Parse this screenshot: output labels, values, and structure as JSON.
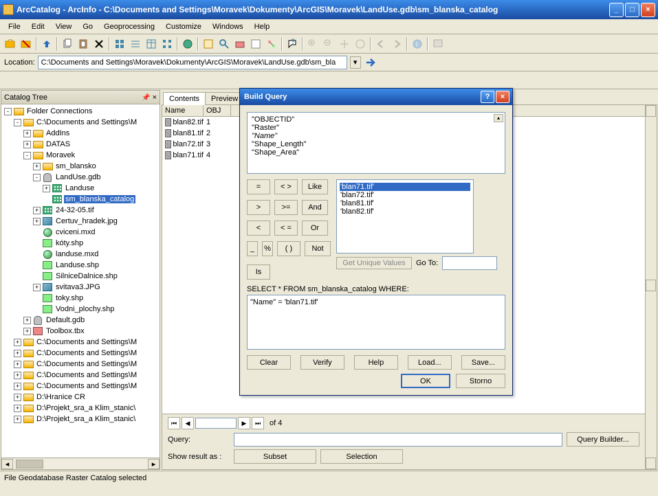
{
  "titlebar": "ArcCatalog - ArcInfo - C:\\Documents and Settings\\Moravek\\Dokumenty\\ArcGIS\\Moravek\\LandUse.gdb\\sm_blanska_catalog",
  "menu": [
    "File",
    "Edit",
    "View",
    "Go",
    "Geoprocessing",
    "Customize",
    "Windows",
    "Help"
  ],
  "location_label": "Location:",
  "location_value": "C:\\Documents and Settings\\Moravek\\Dokumenty\\ArcGIS\\Moravek\\LandUse.gdb\\sm_bla",
  "sidebar_title": "Catalog Tree",
  "tree": [
    {
      "ind": 0,
      "exp": "-",
      "icon": "fold-open",
      "label": "Folder Connections"
    },
    {
      "ind": 1,
      "exp": "-",
      "icon": "fold-open",
      "label": "C:\\Documents and Settings\\M"
    },
    {
      "ind": 2,
      "exp": "+",
      "icon": "fold",
      "label": "AddIns"
    },
    {
      "ind": 2,
      "exp": "+",
      "icon": "fold",
      "label": "DATAS"
    },
    {
      "ind": 2,
      "exp": "-",
      "icon": "fold-open",
      "label": "Moravek"
    },
    {
      "ind": 3,
      "exp": "+",
      "icon": "fold",
      "label": "sm_blansko"
    },
    {
      "ind": 3,
      "exp": "-",
      "icon": "db",
      "label": "LandUse.gdb"
    },
    {
      "ind": 4,
      "exp": "+",
      "icon": "grid-ic",
      "label": "Landuse"
    },
    {
      "ind": 4,
      "exp": "",
      "icon": "grid-ic",
      "label": "sm_blanska_catalog",
      "sel": true
    },
    {
      "ind": 3,
      "exp": "+",
      "icon": "grid-ic",
      "label": "24-32-05.tif"
    },
    {
      "ind": 3,
      "exp": "+",
      "icon": "img-ic",
      "label": "Certuv_hradek.jpg"
    },
    {
      "ind": 3,
      "exp": "",
      "icon": "globe-ic",
      "label": "cviceni.mxd"
    },
    {
      "ind": 3,
      "exp": "",
      "icon": "shp-ic",
      "label": "kóty.shp"
    },
    {
      "ind": 3,
      "exp": "",
      "icon": "globe-ic",
      "label": "landuse.mxd"
    },
    {
      "ind": 3,
      "exp": "",
      "icon": "shp-ic",
      "label": "Landuse.shp"
    },
    {
      "ind": 3,
      "exp": "",
      "icon": "shp-ic",
      "label": "SilniceDalnice.shp"
    },
    {
      "ind": 3,
      "exp": "+",
      "icon": "img-ic",
      "label": "svitava3.JPG"
    },
    {
      "ind": 3,
      "exp": "",
      "icon": "shp-ic",
      "label": "toky.shp"
    },
    {
      "ind": 3,
      "exp": "",
      "icon": "shp-ic",
      "label": "Vodni_plochy.shp"
    },
    {
      "ind": 2,
      "exp": "+",
      "icon": "db",
      "label": "Default.gdb"
    },
    {
      "ind": 2,
      "exp": "+",
      "icon": "tool-ic",
      "label": "Toolbox.tbx"
    },
    {
      "ind": 1,
      "exp": "+",
      "icon": "fold",
      "label": "C:\\Documents and Settings\\M"
    },
    {
      "ind": 1,
      "exp": "+",
      "icon": "fold",
      "label": "C:\\Documents and Settings\\M"
    },
    {
      "ind": 1,
      "exp": "+",
      "icon": "fold",
      "label": "C:\\Documents and Settings\\M"
    },
    {
      "ind": 1,
      "exp": "+",
      "icon": "fold",
      "label": "C:\\Documents and Settings\\M"
    },
    {
      "ind": 1,
      "exp": "+",
      "icon": "fold",
      "label": "C:\\Documents and Settings\\M"
    },
    {
      "ind": 1,
      "exp": "+",
      "icon": "fold",
      "label": "D:\\Hranice CR"
    },
    {
      "ind": 1,
      "exp": "+",
      "icon": "fold",
      "label": "D:\\Projekt_sra_a Klim_stanic\\"
    },
    {
      "ind": 1,
      "exp": "+",
      "icon": "fold",
      "label": "D:\\Projekt_sra_a Klim_stanic\\"
    }
  ],
  "tabs": [
    "Contents",
    "Preview"
  ],
  "list_headers": [
    "Name",
    "OBJ"
  ],
  "list_rows": [
    {
      "name": "blan82.tif",
      "obj": "1"
    },
    {
      "name": "blan81.tif",
      "obj": "2"
    },
    {
      "name": "blan72.tif",
      "obj": "3"
    },
    {
      "name": "blan71.tif",
      "obj": "4"
    }
  ],
  "nav_of": "of 4",
  "query_label": "Query:",
  "query_value": "",
  "query_builder_btn": "Query Builder...",
  "show_label": "Show result as :",
  "subset_btn": "Subset",
  "selection_btn": "Selection",
  "status": "File Geodatabase Raster Catalog selected",
  "dialog": {
    "title": "Build Query",
    "fields": [
      "\"OBJECTID\"",
      "\"Raster\"",
      "\"Name\"",
      "\"Shape_Length\"",
      "\"Shape_Area\""
    ],
    "field_sel": 2,
    "ops": [
      [
        "=",
        "< >",
        "Like"
      ],
      [
        ">",
        ">=",
        "And"
      ],
      [
        "<",
        "< =",
        "Or"
      ],
      [
        "_",
        "%",
        "( )",
        "Not"
      ]
    ],
    "is_btn": "Is",
    "values": [
      "'blan71.tif'",
      "'blan72.tif'",
      "'blan81.tif'",
      "'blan82.tif'"
    ],
    "value_sel": 0,
    "get_unique": "Get Unique Values",
    "goto": "Go To:",
    "select_text": "SELECT * FROM sm_blanska_catalog WHERE:",
    "where_text": "\"Name\" = 'blan71.tif'",
    "btns": [
      "Clear",
      "Verify",
      "Help",
      "Load...",
      "Save..."
    ],
    "ok": "OK",
    "cancel": "Storno"
  }
}
